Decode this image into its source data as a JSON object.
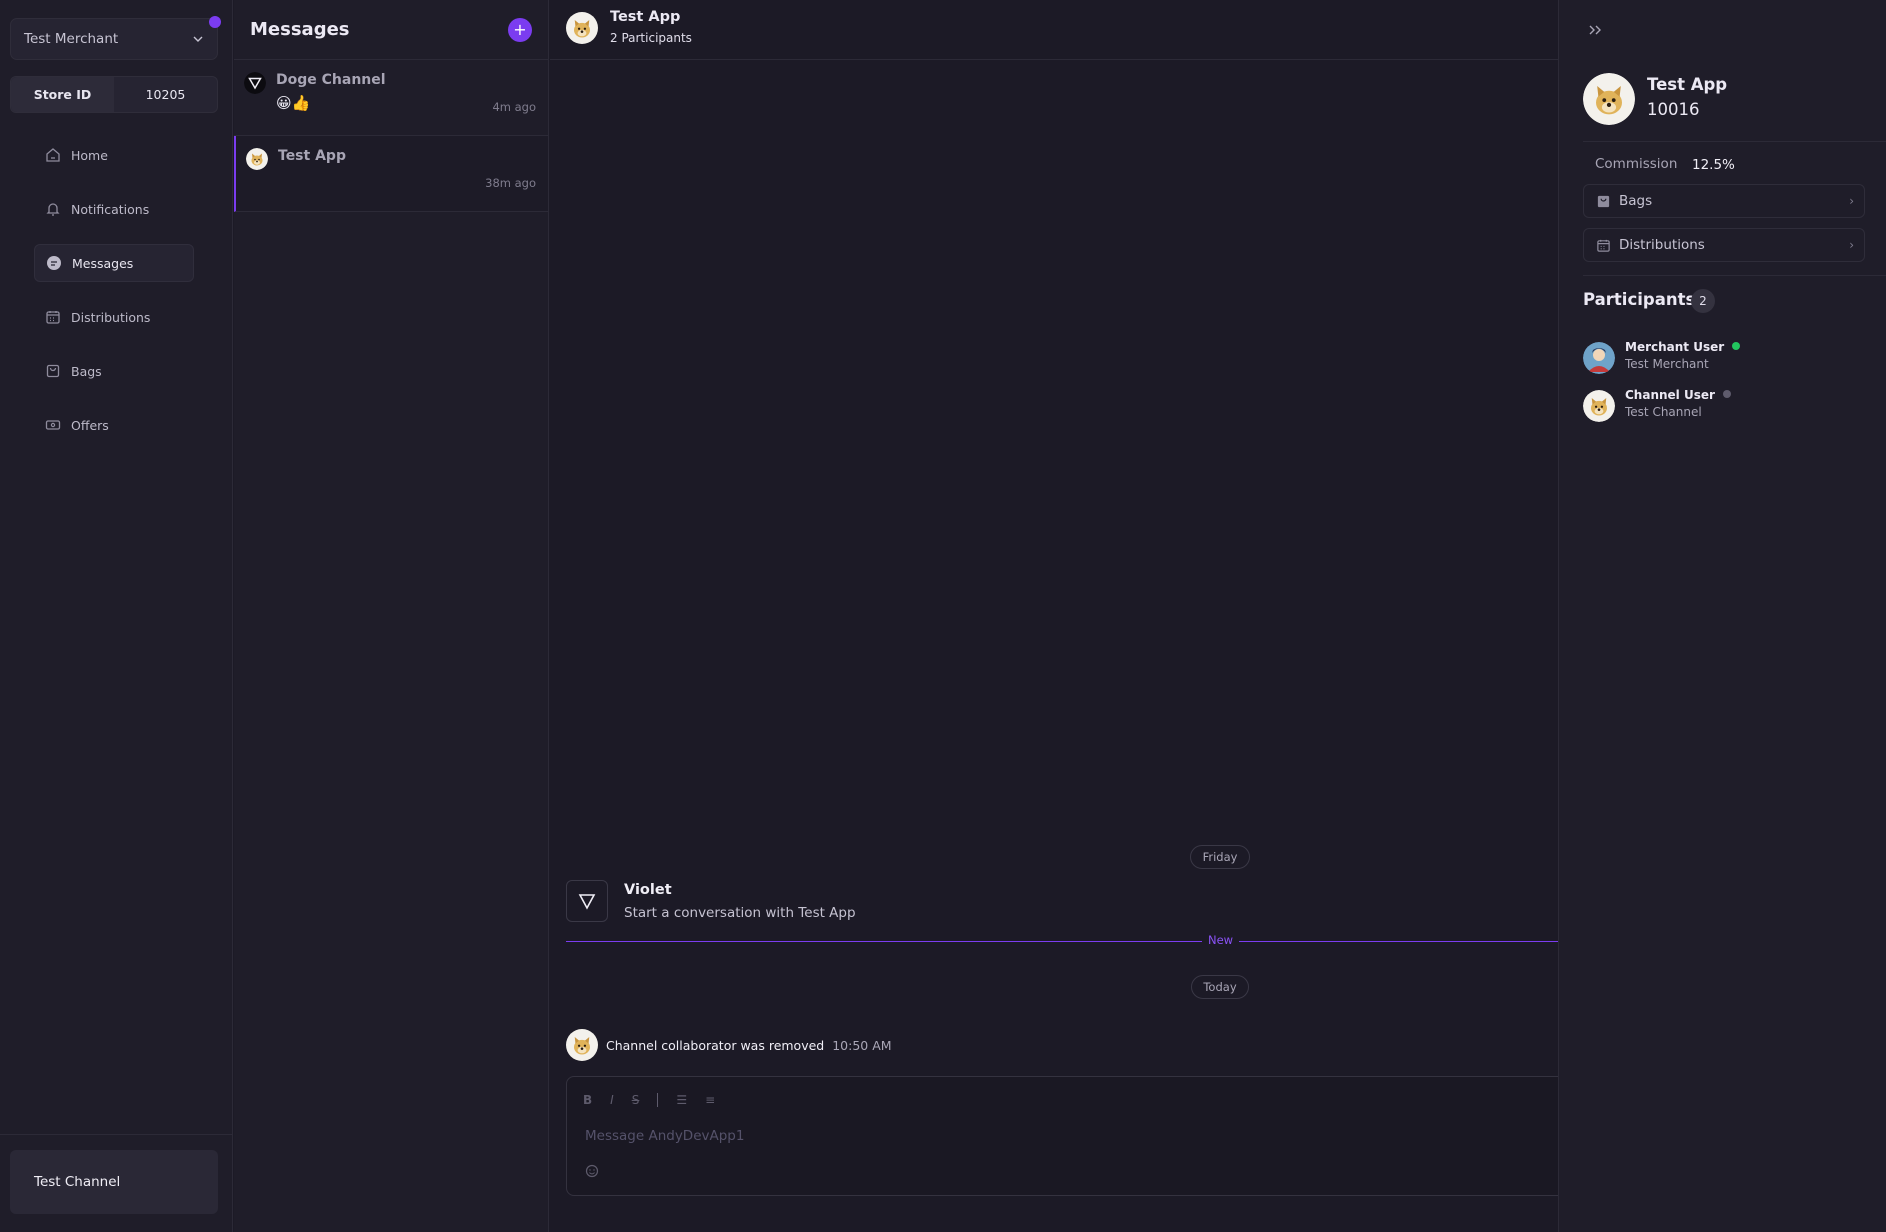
{
  "sidebar": {
    "merchant_name": "Test Merchant",
    "store_id_label": "Store ID",
    "store_id_value": "10205",
    "nav": [
      {
        "label": "Home",
        "icon": "home-icon"
      },
      {
        "label": "Notifications",
        "icon": "bell-icon"
      },
      {
        "label": "Messages",
        "icon": "chat-icon",
        "active": true
      },
      {
        "label": "Distributions",
        "icon": "calendar-icon"
      },
      {
        "label": "Bags",
        "icon": "bag-icon"
      },
      {
        "label": "Offers",
        "icon": "ticket-icon"
      }
    ],
    "channel_name": "Test Channel"
  },
  "conversations": {
    "title": "Messages",
    "add_icon": "plus-icon",
    "items": [
      {
        "name": "Doge Channel",
        "preview": "😀👍",
        "time": "4m ago",
        "avatar": "triangle-logo"
      },
      {
        "name": "Test App",
        "preview": "",
        "time": "38m ago",
        "avatar": "doge-avatar",
        "active": true
      }
    ]
  },
  "chat": {
    "title": "Test App",
    "participants_label": "2 Participants",
    "day_friday": "Friday",
    "sender": "Violet",
    "sender_message": "Start a conversation with Test App",
    "new_label": "New",
    "day_today": "Today",
    "system_message": "Channel collaborator was removed",
    "system_time": "10:50 AM",
    "composer_placeholder": "Message AndyDevApp1",
    "toolbar": [
      "B",
      "I",
      "S",
      "|",
      "☰",
      "≡"
    ]
  },
  "details": {
    "app_name": "Test App",
    "app_id": "10016",
    "commission_label": "Commission",
    "commission_value": "12.5%",
    "bags_label": "Bags",
    "distributions_label": "Distributions",
    "participants_title": "Participants",
    "participants_count": "2",
    "participants": [
      {
        "name": "Merchant User",
        "org": "Test Merchant",
        "status": "online",
        "status_color": "#22c55e"
      },
      {
        "name": "Channel User",
        "org": "Test Channel",
        "status": "offline",
        "status_color": "#5e5b6c"
      }
    ]
  },
  "colors": {
    "accent": "#7b3cf0",
    "background": "#1c1a26",
    "panel": "#1f1d29"
  }
}
